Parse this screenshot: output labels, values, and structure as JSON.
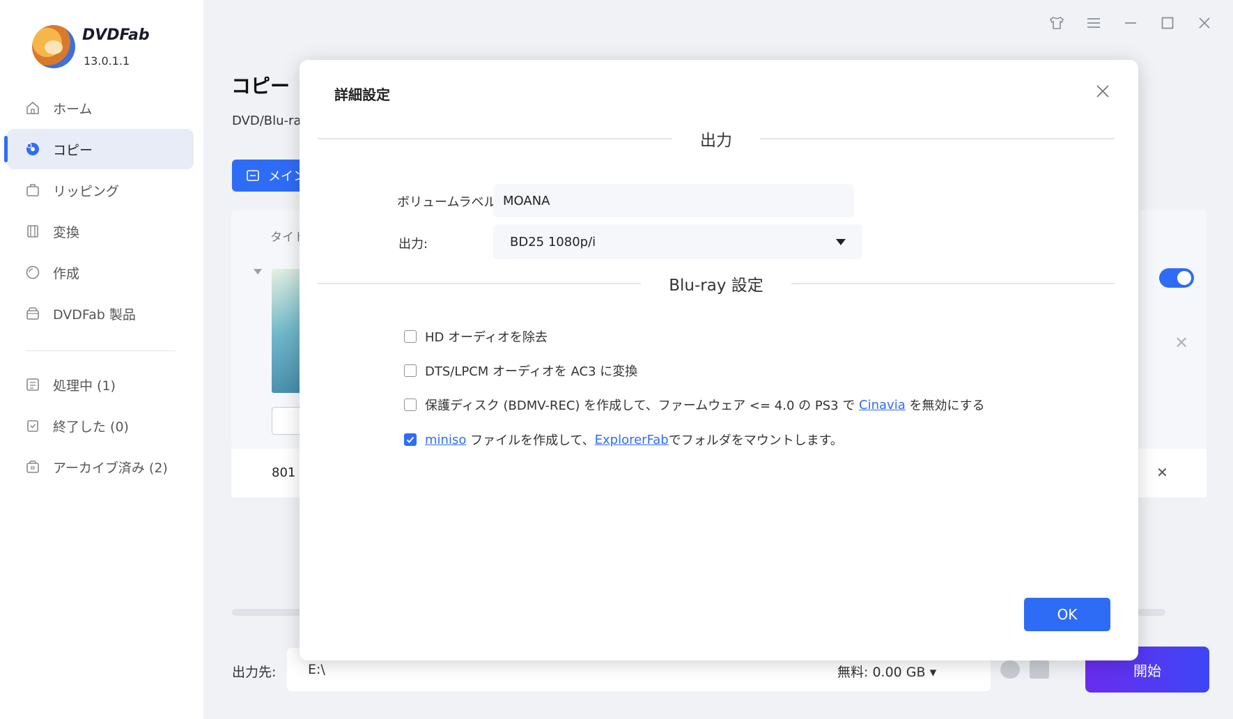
{
  "app": {
    "name": "DVDFab",
    "version": "13.0.1.1"
  },
  "sidebar": {
    "items": [
      {
        "label": "ホーム"
      },
      {
        "label": "コピー"
      },
      {
        "label": "リッピング"
      },
      {
        "label": "変換"
      },
      {
        "label": "作成"
      },
      {
        "label": "DVDFab 製品"
      }
    ],
    "queue": [
      {
        "label": "処理中 (1)"
      },
      {
        "label": "終了した (0)"
      },
      {
        "label": "アーカイブ済み (2)"
      }
    ]
  },
  "main": {
    "title": "コピー",
    "subtitle": "DVD/Blu-ra",
    "mode_button": "メイン",
    "column_header": "タイト",
    "row_number": "801",
    "output_label": "出力先:",
    "output_path": "E:\\",
    "free_space": "無料: 0.00 GB",
    "start_button": "開始"
  },
  "dialog": {
    "title": "詳細設定",
    "output_section": "出力",
    "volume_label": "ボリュームラベル:",
    "volume_value": "MOANA",
    "output_label": "出力:",
    "output_value": "BD25 1080p/i",
    "bluray_section": "Blu-ray 設定",
    "options": {
      "remove_hd_audio": {
        "text": "HD オーディオを除去",
        "checked": false
      },
      "dts_to_ac3": {
        "text": "DTS/LPCM オーディオを AC3 に変換",
        "checked": false
      },
      "protected_disc": {
        "before": "保護ディスク (BDMV-REC) を作成して、ファームウェア <= 4.0 の PS3 で ",
        "link": "Cinavia",
        "after": " を無効にする",
        "checked": false
      },
      "miniso": {
        "link1": "miniso",
        "middle": " ファイルを作成して、",
        "link2": "ExplorerFab",
        "after": "でフォルダをマウントします。",
        "checked": true
      }
    },
    "ok_button": "OK"
  },
  "colors": {
    "accent": "#2f6cf6",
    "start_gradient_from": "#6a2cf0",
    "start_gradient_to": "#3d46f5"
  }
}
